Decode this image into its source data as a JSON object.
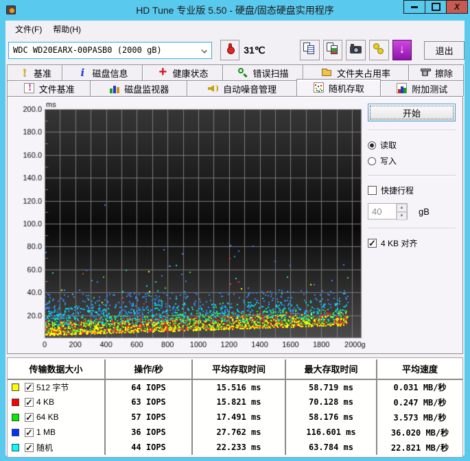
{
  "window": {
    "title": "HD Tune 专业版 5.50 - 硬盘/固态硬盘实用程序",
    "caption_buttons": [
      "minimize-icon",
      "maximize-icon",
      "close-icon"
    ]
  },
  "menu": {
    "items": [
      {
        "label": "文件(F)"
      },
      {
        "label": "帮助(H)"
      }
    ]
  },
  "toolbar": {
    "drive_selected": "WDC WD20EARX-00PASB0  (2000 gB)",
    "temperature": "31℃",
    "buttons": [
      "copy-text-icon",
      "copy-image-icon",
      "camera-icon",
      "coins-icon",
      "download-icon"
    ],
    "exit_label": "退出"
  },
  "tabs": {
    "row1": [
      {
        "label": "基准",
        "icon": "benchmark-icon"
      },
      {
        "label": "磁盘信息",
        "icon": "disk-info-icon"
      },
      {
        "label": "健康状态",
        "icon": "health-icon"
      },
      {
        "label": "错误扫描",
        "icon": "error-scan-icon"
      },
      {
        "label": "文件夹占用率",
        "icon": "folder-usage-icon"
      },
      {
        "label": "擦除",
        "icon": "erase-icon"
      }
    ],
    "row2": [
      {
        "label": "文件基准",
        "icon": "file-benchmark-icon"
      },
      {
        "label": "磁盘监视器",
        "icon": "disk-monitor-icon"
      },
      {
        "label": "自动噪音管理",
        "icon": "aam-icon"
      },
      {
        "label": "随机存取",
        "icon": "random-access-icon",
        "active": true
      },
      {
        "label": "附加测试",
        "icon": "extra-tests-icon"
      }
    ]
  },
  "controls": {
    "start_label": "开始",
    "read_label": "读取",
    "read_checked": true,
    "write_label": "写入",
    "write_checked": false,
    "shortstroke_label": "快捷行程",
    "shortstroke_checked": false,
    "capacity_value": "40",
    "capacity_unit": "gB",
    "align_label": "4 KB 对齐",
    "align_checked": true
  },
  "chart_data": {
    "type": "scatter",
    "ylabel": "ms",
    "x_suffix": "gB",
    "xlim": [
      0,
      2000
    ],
    "ylim": [
      0,
      200
    ],
    "x_label_step": 200,
    "x_grid_step": 100,
    "y_label_step": 20,
    "y_minor_step": 10,
    "grid": true,
    "seed": 1337,
    "series": [
      {
        "name": "512 字节",
        "color": "#ffff00",
        "point_color": "#ffff00",
        "iops": 64,
        "avg_ms": 15.516,
        "max_ms": 58.719,
        "speed_mb_s": 0.031,
        "gen": {
          "n": 650,
          "min0": 3,
          "min1": 12,
          "spread": 11,
          "pow": 2.0,
          "tail": 0.01,
          "tail_max": 55
        }
      },
      {
        "name": "4 KB",
        "color": "#ff0000",
        "point_color": "#ff3322",
        "iops": 63,
        "avg_ms": 15.821,
        "max_ms": 70.128,
        "speed_mb_s": 0.247,
        "gen": {
          "n": 650,
          "min0": 3.5,
          "min1": 13,
          "spread": 12,
          "pow": 2.1,
          "tail": 0.01,
          "tail_max": 64
        }
      },
      {
        "name": "64 KB",
        "color": "#00ee00",
        "point_color": "#33ee33",
        "iops": 57,
        "avg_ms": 17.491,
        "max_ms": 58.176,
        "speed_mb_s": 3.573,
        "gen": {
          "n": 650,
          "min0": 4.5,
          "min1": 14,
          "spread": 13,
          "pow": 1.9,
          "tail": 0.018,
          "tail_max": 58
        }
      },
      {
        "name": "1 MB",
        "color": "#0033ff",
        "point_color": "#2e8bff",
        "iops": 36,
        "avg_ms": 27.762,
        "max_ms": 116.601,
        "speed_mb_s": 36.02,
        "gen": {
          "n": 500,
          "min0": 17,
          "min1": 22,
          "spread": 22,
          "pow": 1.3,
          "tail": 0.05,
          "tail_max": 82
        }
      },
      {
        "name": "随机",
        "color": "#00ffff",
        "point_color": "#00e8e8",
        "iops": 44,
        "avg_ms": 22.233,
        "max_ms": 63.784,
        "speed_mb_s": 22.821,
        "gen": {
          "n": 500,
          "min0": 12,
          "min1": 17,
          "spread": 17,
          "pow": 1.5,
          "tail": 0.025,
          "tail_max": 60
        }
      }
    ]
  },
  "table": {
    "headers": [
      "传输数据大小",
      "操作/秒",
      "平均存取时间",
      "最大存取时间",
      "平均速度"
    ],
    "rows": [
      {
        "color": "#ffff00",
        "checked": true,
        "label": "512 字节",
        "ops": "64 IOPS",
        "avg": "15.516 ms",
        "max": "58.719 ms",
        "speed": "0.031 MB/秒"
      },
      {
        "color": "#ff0000",
        "checked": true,
        "label": "4 KB",
        "ops": "63 IOPS",
        "avg": "15.821 ms",
        "max": "70.128 ms",
        "speed": "0.247 MB/秒"
      },
      {
        "color": "#00ee00",
        "checked": true,
        "label": "64 KB",
        "ops": "57 IOPS",
        "avg": "17.491 ms",
        "max": "58.176 ms",
        "speed": "3.573 MB/秒"
      },
      {
        "color": "#0033ff",
        "checked": true,
        "label": "1 MB",
        "ops": "36 IOPS",
        "avg": "27.762 ms",
        "max": "116.601 ms",
        "speed": "36.020 MB/秒"
      },
      {
        "color": "#00ffff",
        "checked": true,
        "label": "随机",
        "ops": "44 IOPS",
        "avg": "22.233 ms",
        "max": "63.784 ms",
        "speed": "22.821 MB/秒"
      }
    ]
  }
}
